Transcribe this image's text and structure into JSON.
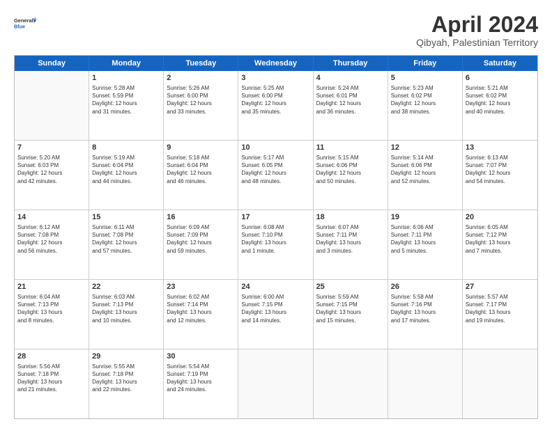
{
  "logo": {
    "line1": "General",
    "line2": "Blue"
  },
  "title": "April 2024",
  "location": "Qibyah, Palestinian Territory",
  "weekdays": [
    "Sunday",
    "Monday",
    "Tuesday",
    "Wednesday",
    "Thursday",
    "Friday",
    "Saturday"
  ],
  "rows": [
    [
      {
        "day": "",
        "info": ""
      },
      {
        "day": "1",
        "info": "Sunrise: 5:28 AM\nSunset: 5:59 PM\nDaylight: 12 hours\nand 31 minutes."
      },
      {
        "day": "2",
        "info": "Sunrise: 5:26 AM\nSunset: 6:00 PM\nDaylight: 12 hours\nand 33 minutes."
      },
      {
        "day": "3",
        "info": "Sunrise: 5:25 AM\nSunset: 6:00 PM\nDaylight: 12 hours\nand 35 minutes."
      },
      {
        "day": "4",
        "info": "Sunrise: 5:24 AM\nSunset: 6:01 PM\nDaylight: 12 hours\nand 36 minutes."
      },
      {
        "day": "5",
        "info": "Sunrise: 5:23 AM\nSunset: 6:02 PM\nDaylight: 12 hours\nand 38 minutes."
      },
      {
        "day": "6",
        "info": "Sunrise: 5:21 AM\nSunset: 6:02 PM\nDaylight: 12 hours\nand 40 minutes."
      }
    ],
    [
      {
        "day": "7",
        "info": "Sunrise: 5:20 AM\nSunset: 6:03 PM\nDaylight: 12 hours\nand 42 minutes."
      },
      {
        "day": "8",
        "info": "Sunrise: 5:19 AM\nSunset: 6:04 PM\nDaylight: 12 hours\nand 44 minutes."
      },
      {
        "day": "9",
        "info": "Sunrise: 5:18 AM\nSunset: 6:04 PM\nDaylight: 12 hours\nand 46 minutes."
      },
      {
        "day": "10",
        "info": "Sunrise: 5:17 AM\nSunset: 6:05 PM\nDaylight: 12 hours\nand 48 minutes."
      },
      {
        "day": "11",
        "info": "Sunrise: 5:15 AM\nSunset: 6:06 PM\nDaylight: 12 hours\nand 50 minutes."
      },
      {
        "day": "12",
        "info": "Sunrise: 5:14 AM\nSunset: 6:06 PM\nDaylight: 12 hours\nand 52 minutes."
      },
      {
        "day": "13",
        "info": "Sunrise: 6:13 AM\nSunset: 7:07 PM\nDaylight: 12 hours\nand 54 minutes."
      }
    ],
    [
      {
        "day": "14",
        "info": "Sunrise: 6:12 AM\nSunset: 7:08 PM\nDaylight: 12 hours\nand 56 minutes."
      },
      {
        "day": "15",
        "info": "Sunrise: 6:11 AM\nSunset: 7:08 PM\nDaylight: 12 hours\nand 57 minutes."
      },
      {
        "day": "16",
        "info": "Sunrise: 6:09 AM\nSunset: 7:09 PM\nDaylight: 12 hours\nand 59 minutes."
      },
      {
        "day": "17",
        "info": "Sunrise: 6:08 AM\nSunset: 7:10 PM\nDaylight: 13 hours\nand 1 minute."
      },
      {
        "day": "18",
        "info": "Sunrise: 6:07 AM\nSunset: 7:11 PM\nDaylight: 13 hours\nand 3 minutes."
      },
      {
        "day": "19",
        "info": "Sunrise: 6:06 AM\nSunset: 7:11 PM\nDaylight: 13 hours\nand 5 minutes."
      },
      {
        "day": "20",
        "info": "Sunrise: 6:05 AM\nSunset: 7:12 PM\nDaylight: 13 hours\nand 7 minutes."
      }
    ],
    [
      {
        "day": "21",
        "info": "Sunrise: 6:04 AM\nSunset: 7:13 PM\nDaylight: 13 hours\nand 8 minutes."
      },
      {
        "day": "22",
        "info": "Sunrise: 6:03 AM\nSunset: 7:13 PM\nDaylight: 13 hours\nand 10 minutes."
      },
      {
        "day": "23",
        "info": "Sunrise: 6:02 AM\nSunset: 7:14 PM\nDaylight: 13 hours\nand 12 minutes."
      },
      {
        "day": "24",
        "info": "Sunrise: 6:00 AM\nSunset: 7:15 PM\nDaylight: 13 hours\nand 14 minutes."
      },
      {
        "day": "25",
        "info": "Sunrise: 5:59 AM\nSunset: 7:15 PM\nDaylight: 13 hours\nand 15 minutes."
      },
      {
        "day": "26",
        "info": "Sunrise: 5:58 AM\nSunset: 7:16 PM\nDaylight: 13 hours\nand 17 minutes."
      },
      {
        "day": "27",
        "info": "Sunrise: 5:57 AM\nSunset: 7:17 PM\nDaylight: 13 hours\nand 19 minutes."
      }
    ],
    [
      {
        "day": "28",
        "info": "Sunrise: 5:56 AM\nSunset: 7:18 PM\nDaylight: 13 hours\nand 21 minutes."
      },
      {
        "day": "29",
        "info": "Sunrise: 5:55 AM\nSunset: 7:18 PM\nDaylight: 13 hours\nand 22 minutes."
      },
      {
        "day": "30",
        "info": "Sunrise: 5:54 AM\nSunset: 7:19 PM\nDaylight: 13 hours\nand 24 minutes."
      },
      {
        "day": "",
        "info": ""
      },
      {
        "day": "",
        "info": ""
      },
      {
        "day": "",
        "info": ""
      },
      {
        "day": "",
        "info": ""
      }
    ]
  ]
}
